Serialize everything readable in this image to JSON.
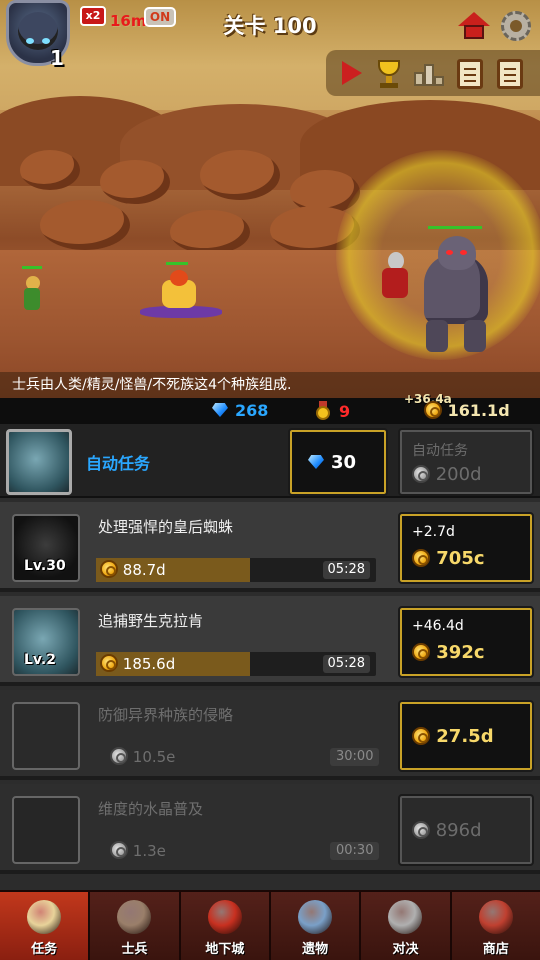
{
  "hud": {
    "player_level": "1",
    "speed_multiplier": "x2",
    "speed_time": "16m",
    "speed_toggle": "ON",
    "stage_title": "关卡 100"
  },
  "scene": {
    "tip": "士兵由人类/精灵/怪兽/不死族这4个种族组成."
  },
  "resources": {
    "gems": "268",
    "medals": "9",
    "gold_delta": "+36.4a",
    "gold": "161.1d"
  },
  "auto_task": {
    "label": "自动任务",
    "gem_cost": "30",
    "gold_label": "自动任务",
    "gold_cost": "200d"
  },
  "quests": [
    {
      "name": "处理强悍的皇后蜘蛛",
      "level": "Lv.30",
      "reward": "88.7d",
      "time": "05:28",
      "progress": 0.55,
      "upgrade_delta": "+2.7d",
      "upgrade_cost": "705c",
      "locked": false
    },
    {
      "name": "追捕野生克拉肯",
      "level": "Lv.2",
      "reward": "185.6d",
      "time": "05:28",
      "progress": 0.55,
      "upgrade_delta": "+46.4d",
      "upgrade_cost": "392c",
      "locked": false
    },
    {
      "name": "防御异界种族的侵略",
      "level": "",
      "reward": "10.5e",
      "time": "30:00",
      "progress": 0,
      "upgrade_delta": "",
      "upgrade_cost": "27.5d",
      "locked": true
    },
    {
      "name": "维度的水晶普及",
      "level": "",
      "reward": "1.3e",
      "time": "00:30",
      "progress": 0,
      "upgrade_delta": "",
      "upgrade_cost": "896d",
      "locked": true
    }
  ],
  "nav": {
    "items": [
      {
        "label": "任务",
        "icon": "scroll-icon",
        "color": "#e8d39a"
      },
      {
        "label": "士兵",
        "icon": "soldier-icon",
        "color": "#9a7f6a"
      },
      {
        "label": "地下城",
        "icon": "dungeon-icon",
        "color": "#c83020"
      },
      {
        "label": "遗物",
        "icon": "relic-icon",
        "color": "#7aa0c8"
      },
      {
        "label": "对决",
        "icon": "swords-icon",
        "color": "#b0b0b0"
      },
      {
        "label": "商店",
        "icon": "shop-icon",
        "color": "#c04030"
      }
    ]
  },
  "colors": {
    "accent_blue": "#2aa7ff",
    "gold_text": "#f7d86a",
    "nav_active": "#c2381c",
    "medal_red": "#ff2a2a"
  }
}
